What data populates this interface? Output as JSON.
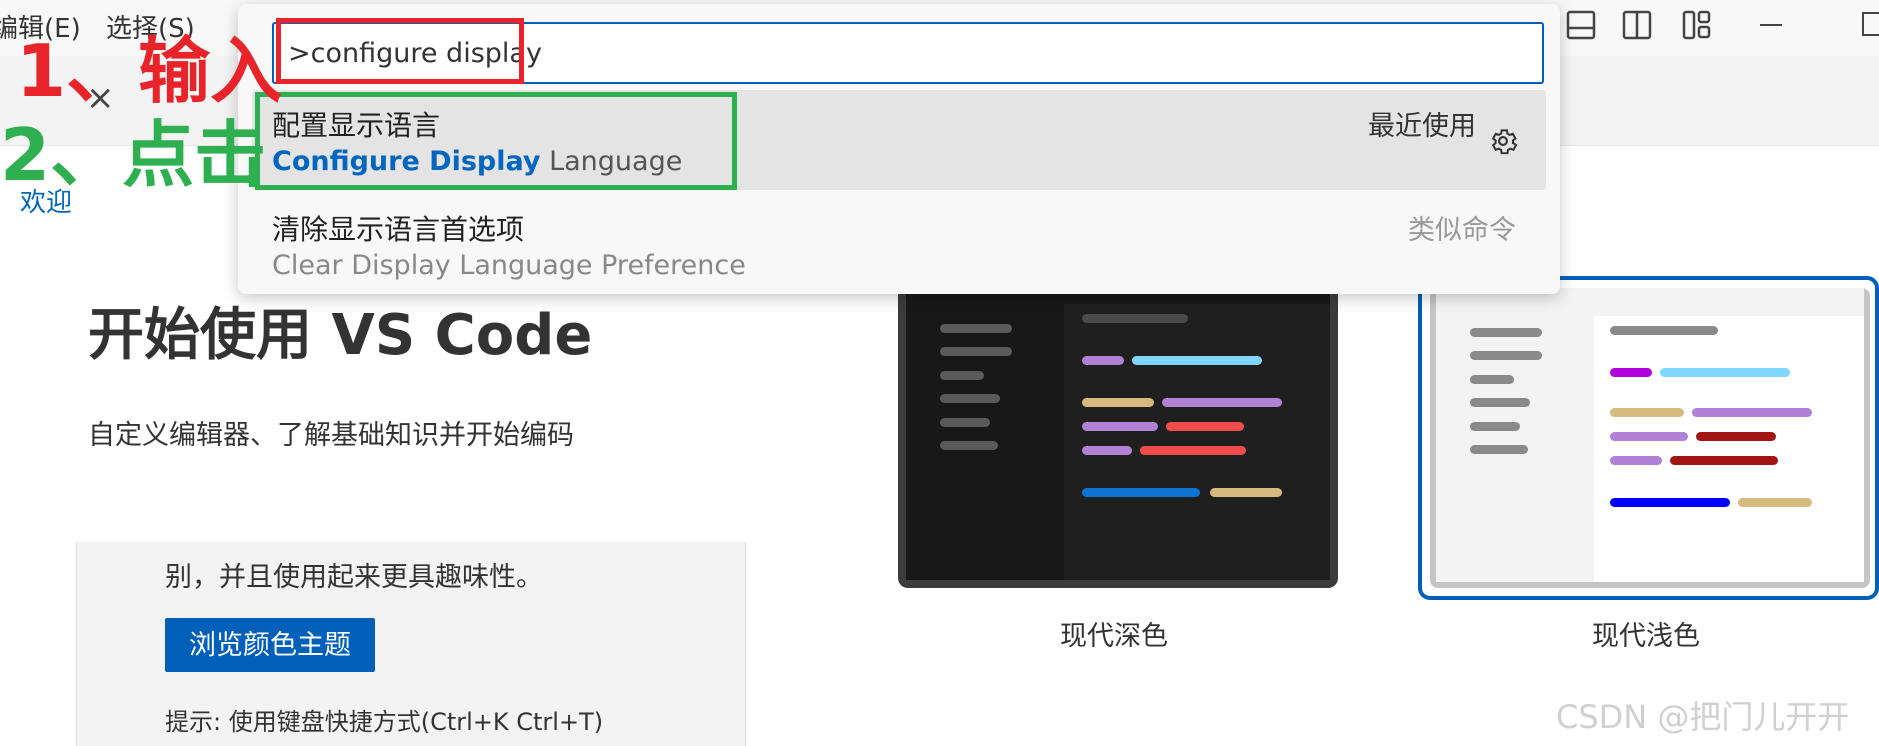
{
  "menubar": {
    "edit": "编辑(E)",
    "selection": "选择(S)"
  },
  "window_icons": [
    "panel-layout-icon",
    "sidebar-layout-icon",
    "customize-layout-icon",
    "minimize-icon",
    "maximize-icon"
  ],
  "tab": {
    "close_symbol": "×",
    "welcome": "欢迎"
  },
  "command_palette": {
    "input_value": ">configure display",
    "results": [
      {
        "title": "配置显示语言",
        "subtitle_highlight": "Configure Display",
        "subtitle_rest": " Language",
        "badge": "最近使用",
        "icon": "gear-icon"
      },
      {
        "title": "清除显示语言首选项",
        "subtitle_highlight": "",
        "subtitle_rest": "Clear Display Language Preference",
        "badge": "类似命令"
      }
    ]
  },
  "annotations": {
    "step1": "1、输入",
    "step2": "2、点击",
    "step1_color": "#e8242a",
    "step2_color": "#2fb050"
  },
  "welcome": {
    "title": "开始使用 VS Code",
    "subtitle": "自定义编辑器、了解基础知识并开始编码",
    "card": {
      "description": "别，并且使用起来更具趣味性。",
      "button": "浏览颜色主题",
      "tip": "提示: 使用键盘快捷方式(Ctrl+K Ctrl+T)"
    },
    "themes": [
      {
        "label": "现代深色",
        "selected": false
      },
      {
        "label": "现代浅色",
        "selected": true
      }
    ]
  },
  "watermark": "CSDN @把门儿开开",
  "colors": {
    "accent": "#005fb8",
    "highlight_text": "#0066bf"
  }
}
